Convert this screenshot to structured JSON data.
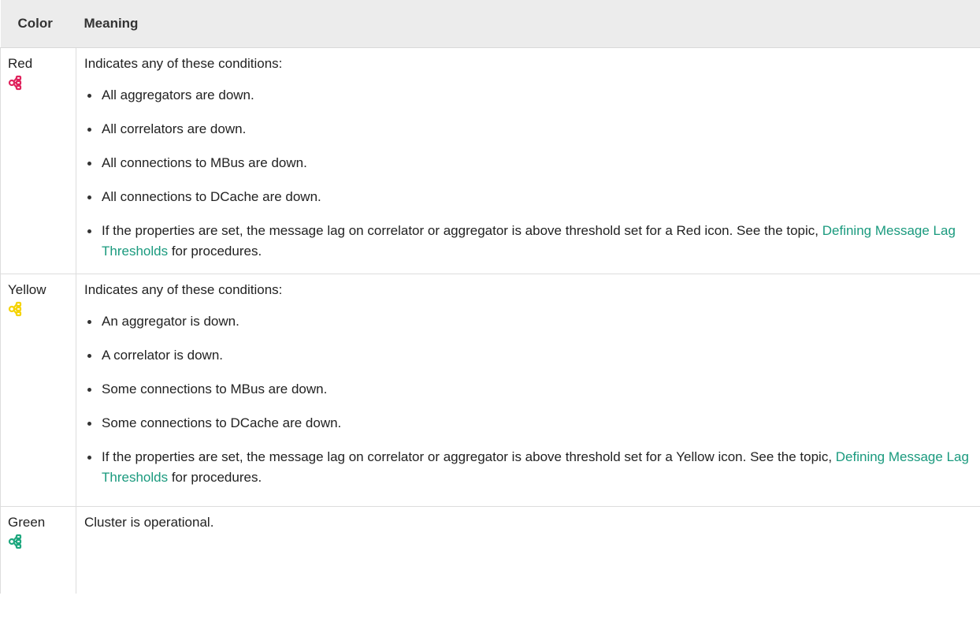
{
  "header": {
    "color": "Color",
    "meaning": "Meaning"
  },
  "rows": [
    {
      "color": "Red",
      "icon": "cluster-icon",
      "icon_color": "#e0245e",
      "intro": "Indicates any of these conditions:",
      "items": [
        "All aggregators are down.",
        "All correlators are down.",
        "All connections to MBus are down.",
        "All connections to DCache are down."
      ],
      "last": {
        "pre": "If the properties are set, the message lag on correlator or aggregator is above threshold set for a Red icon. See the topic, ",
        "link": "Defining Message Lag Thresholds",
        "post": " for procedures."
      }
    },
    {
      "color": "Yellow",
      "icon": "cluster-icon",
      "icon_color": "#f5d300",
      "intro": "Indicates any of these conditions:",
      "items": [
        "An aggregator is down.",
        "A correlator is down.",
        "Some connections to MBus are down.",
        "Some connections to DCache are down."
      ],
      "last": {
        "pre": "If the properties are set, the message lag on correlator or aggregator is above threshold set for a Yellow icon. See the topic, ",
        "link": "Defining Message Lag Thresholds",
        "post": " for procedures."
      }
    },
    {
      "color": "Green",
      "icon": "cluster-icon",
      "icon_color": "#1fa87f",
      "intro": "Cluster is operational."
    }
  ]
}
